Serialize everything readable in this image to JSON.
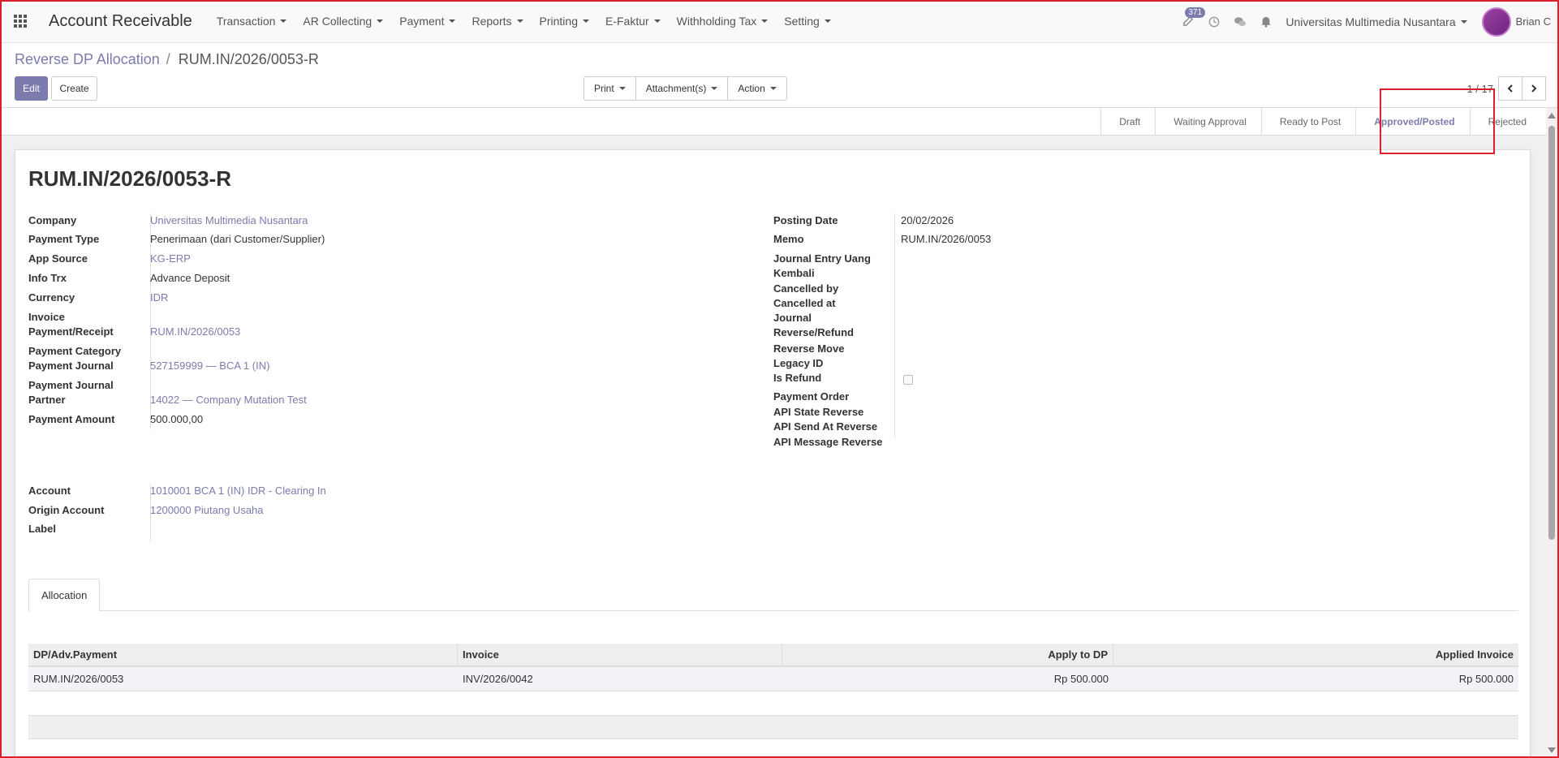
{
  "app": {
    "title": "Account Receivable"
  },
  "menu": [
    "Transaction",
    "AR Collecting",
    "Payment",
    "Reports",
    "Printing",
    "E-Faktur",
    "Withholding Tax",
    "Setting"
  ],
  "systray": {
    "activity_count": "371",
    "company": "Universitas Multimedia Nusantara",
    "user": "Brian C"
  },
  "breadcrumb": {
    "parent": "Reverse DP Allocation",
    "separator": "/",
    "current": "RUM.IN/2026/0053-R"
  },
  "buttons": {
    "edit": "Edit",
    "create": "Create",
    "print": "Print",
    "attachments": "Attachment(s)",
    "action": "Action"
  },
  "pager": {
    "value": "1 / 17"
  },
  "stages": [
    {
      "label": "Draft",
      "active": false
    },
    {
      "label": "Waiting Approval",
      "active": false
    },
    {
      "label": "Ready to Post",
      "active": false
    },
    {
      "label": "Approved/Posted",
      "active": true
    },
    {
      "label": "Rejected",
      "active": false
    }
  ],
  "record": {
    "title": "RUM.IN/2026/0053-R",
    "left_fields": {
      "company": {
        "label": "Company",
        "value": "Universitas Multimedia Nusantara"
      },
      "payment_type": {
        "label": "Payment Type",
        "value": "Penerimaan (dari Customer/Supplier)"
      },
      "app_source": {
        "label": "App Source",
        "value": "KG-ERP"
      },
      "info_trx": {
        "label": "Info Trx",
        "value": "Advance Deposit"
      },
      "currency": {
        "label": "Currency",
        "value": "IDR"
      },
      "invoice": {
        "label": "Invoice",
        "value": ""
      },
      "payment_receipt": {
        "label": "Payment/Receipt",
        "value": "RUM.IN/2026/0053"
      },
      "payment_category": {
        "label": "Payment Category",
        "value": ""
      },
      "payment_journal": {
        "label": "Payment Journal",
        "value": "527159999 — BCA 1 (IN)"
      },
      "payment_journal_partner": {
        "label": "Payment Journal",
        "value": ""
      },
      "partner": {
        "label": "Partner",
        "value": "14022 — Company Mutation Test"
      },
      "payment_amount": {
        "label": "Payment Amount",
        "value": "500.000,00"
      }
    },
    "right_fields": {
      "posting_date": {
        "label": "Posting Date",
        "value": "20/02/2026"
      },
      "memo": {
        "label": "Memo",
        "value": "RUM.IN/2026/0053"
      },
      "journal_entry_uang_kembali": {
        "label": "Journal Entry Uang Kembali",
        "value": ""
      },
      "cancelled_by": {
        "label": "Cancelled by",
        "value": ""
      },
      "cancelled_at": {
        "label": "Cancelled at",
        "value": ""
      },
      "journal_reverse_refund": {
        "label": "Journal Reverse/Refund",
        "value": ""
      },
      "reverse_move": {
        "label": "Reverse Move",
        "value": ""
      },
      "legacy_id": {
        "label": "Legacy ID",
        "value": ""
      },
      "is_refund": {
        "label": "Is Refund",
        "checked": false
      },
      "payment_order": {
        "label": "Payment Order",
        "value": ""
      },
      "api_state_reverse": {
        "label": "API State Reverse",
        "value": ""
      },
      "api_send_at_reverse": {
        "label": "API Send At Reverse",
        "value": ""
      },
      "api_message_reverse": {
        "label": "API Message Reverse",
        "value": ""
      }
    },
    "account_fields": {
      "account": {
        "label": "Account",
        "value": "1010001 BCA 1 (IN) IDR - Clearing In"
      },
      "origin_account": {
        "label": "Origin Account",
        "value": "1200000 Piutang Usaha"
      },
      "label": {
        "label": "Label",
        "value": ""
      }
    }
  },
  "tabs": [
    {
      "label": "Allocation",
      "active": true
    }
  ],
  "allocation_table": {
    "columns": [
      "DP/Adv.Payment",
      "Invoice",
      "Apply to DP",
      "Applied Invoice"
    ],
    "rows": [
      [
        "RUM.IN/2026/0053",
        "INV/2026/0042",
        "Rp 500.000",
        "Rp 500.000"
      ]
    ]
  },
  "colors": {
    "accent": "#7c7bad",
    "highlight": "#d8212d"
  }
}
